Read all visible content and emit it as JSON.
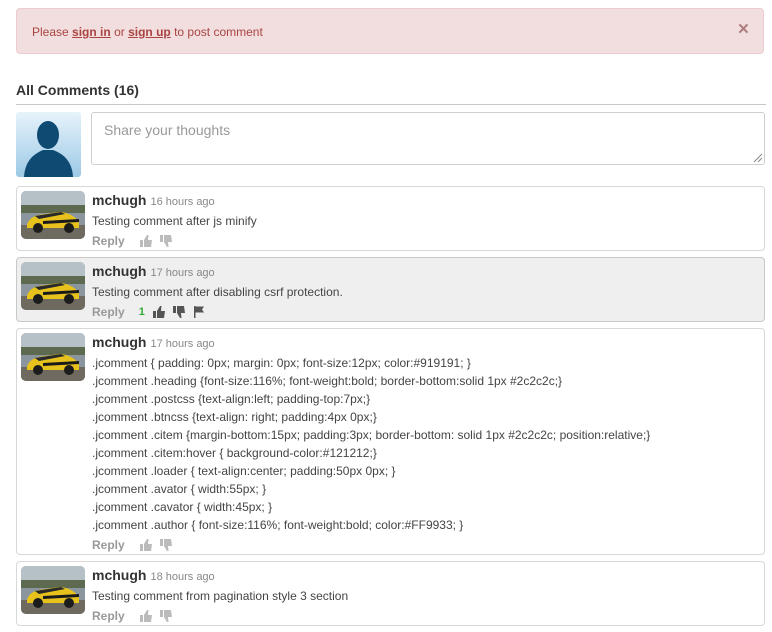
{
  "alert": {
    "prefix": "Please",
    "signin": "sign in",
    "middle": "or",
    "signup": "sign up",
    "suffix": "to post comment",
    "close": "×"
  },
  "heading": {
    "title": "All Comments (16)"
  },
  "compose": {
    "placeholder": "Share your thoughts",
    "value": ""
  },
  "comments": [
    {
      "author": "mchugh",
      "time": "16 hours ago",
      "text": "Testing comment after js minify",
      "reply": "Reply",
      "likes": ""
    },
    {
      "author": "mchugh",
      "time": "17 hours ago",
      "text": "Testing comment after disabling csrf protection.",
      "reply": "Reply",
      "likes": "1"
    },
    {
      "author": "mchugh",
      "time": "17 hours ago",
      "lines": [
        ".jcomment { padding: 0px; margin: 0px; font-size:12px; color:#919191; }",
        ".jcomment .heading {font-size:116%; font-weight:bold; border-bottom:solid 1px #2c2c2c;}",
        ".jcomment .postcss {text-align:left; padding-top:7px;}",
        ".jcomment .btncss {text-align: right; padding:4px 0px;}",
        ".jcomment .citem {margin-bottom:15px; padding:3px; border-bottom: solid 1px #2c2c2c; position:relative;}",
        ".jcomment .citem:hover { background-color:#121212;}",
        ".jcomment .loader { text-align:center; padding:50px 0px; }",
        ".jcomment .avator { width:55px; }",
        ".jcomment .cavator { width:45px; }",
        ".jcomment .author { font-size:116%; font-weight:bold; color:#FF9933; }"
      ],
      "reply": "Reply",
      "likes": ""
    },
    {
      "author": "mchugh",
      "time": "18 hours ago",
      "text": "Testing comment from pagination style 3 section",
      "reply": "Reply",
      "likes": ""
    }
  ]
}
